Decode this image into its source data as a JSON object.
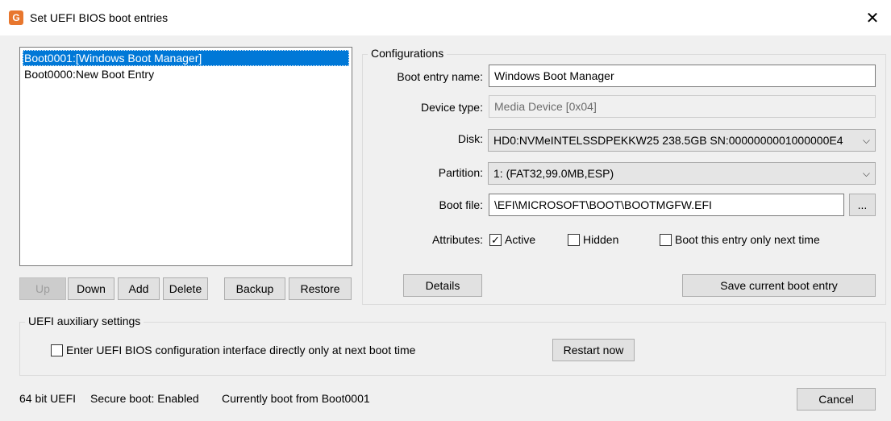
{
  "window": {
    "title": "Set UEFI BIOS boot entries",
    "app_icon_glyph": "G",
    "close_glyph": "✕"
  },
  "boot_list": {
    "items": [
      {
        "label": "Boot0001:[Windows Boot Manager]",
        "selected": true
      },
      {
        "label": "Boot0000:New Boot Entry",
        "selected": false
      }
    ]
  },
  "list_buttons": {
    "up": "Up",
    "down": "Down",
    "add": "Add",
    "delete": "Delete",
    "backup": "Backup",
    "restore": "Restore"
  },
  "config": {
    "legend": "Configurations",
    "boot_entry_name_label": "Boot entry name:",
    "boot_entry_name_value": "Windows Boot Manager",
    "device_type_label": "Device type:",
    "device_type_value": "Media Device [0x04]",
    "disk_label": "Disk:",
    "disk_value": "HD0:NVMeINTELSSDPEKKW25 238.5GB SN:0000000001000000E4",
    "partition_label": "Partition:",
    "partition_value": "1: (FAT32,99.0MB,ESP)",
    "boot_file_label": "Boot file:",
    "boot_file_value": "\\EFI\\MICROSOFT\\BOOT\\BOOTMGFW.EFI",
    "browse_label": "...",
    "attributes_label": "Attributes:",
    "attr_active": "Active",
    "attr_active_checked": true,
    "attr_hidden": "Hidden",
    "attr_hidden_checked": false,
    "attr_next_time": "Boot this entry only next time",
    "attr_next_time_checked": false,
    "details_label": "Details",
    "save_label": "Save current boot entry"
  },
  "aux": {
    "legend": "UEFI auxiliary settings",
    "enter_bios_label": "Enter UEFI BIOS configuration interface directly only at next boot time",
    "enter_bios_checked": false,
    "restart_label": "Restart now"
  },
  "status": {
    "arch": "64 bit UEFI",
    "secure_boot": "Secure boot: Enabled",
    "current_boot": "Currently boot from Boot0001"
  },
  "cancel_label": "Cancel",
  "colors": {
    "accent": "#0078d7",
    "app_icon": "#e8772e",
    "window_bg": "#f0f0f0"
  }
}
